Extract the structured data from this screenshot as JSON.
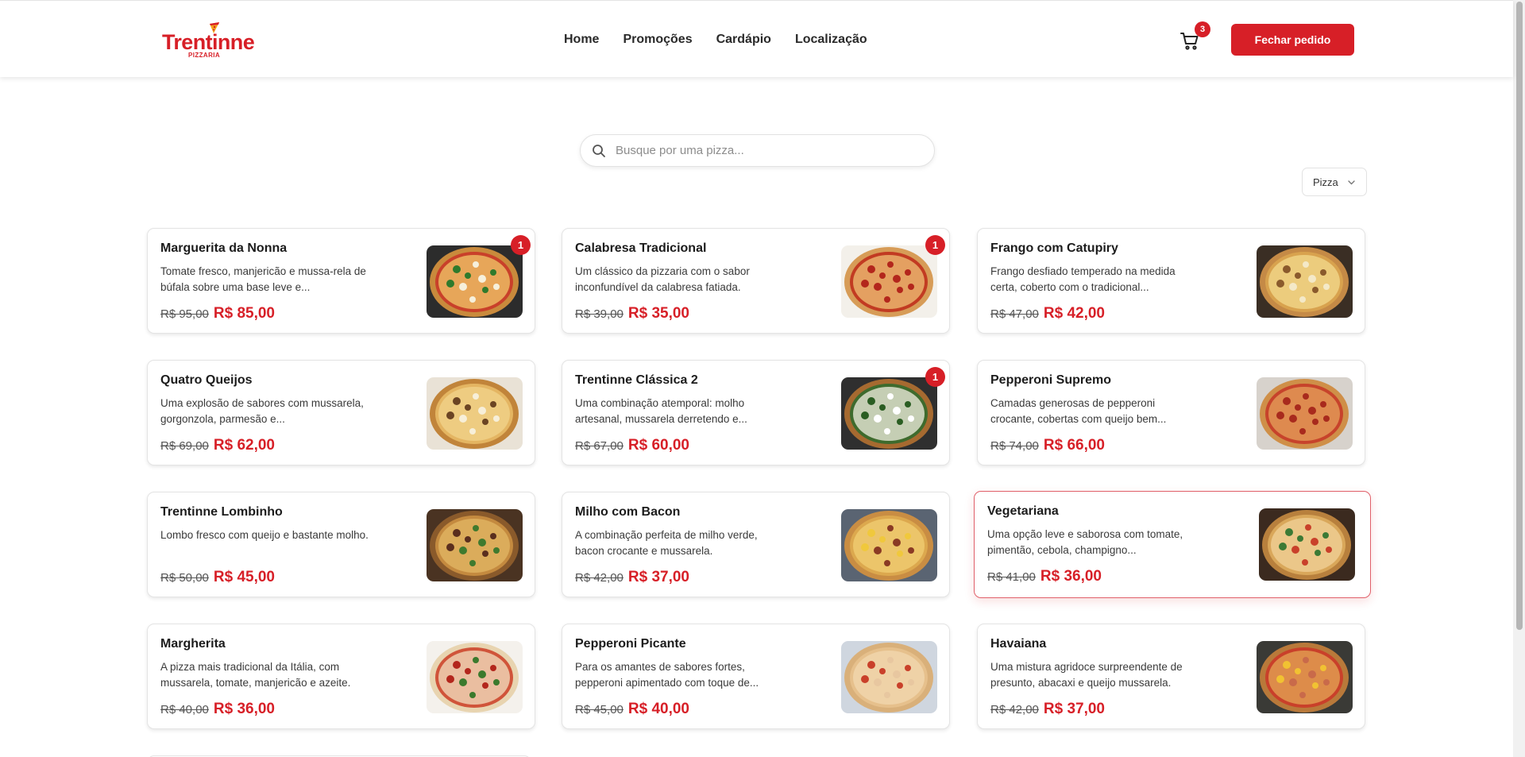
{
  "brand": {
    "name": "Trentinne",
    "subtitle": "PIZZARIA"
  },
  "nav": {
    "items": [
      "Home",
      "Promoções",
      "Cardápio",
      "Localização"
    ]
  },
  "cart": {
    "count": "3",
    "icon": "cart-icon"
  },
  "checkout": {
    "label": "Fechar pedido"
  },
  "search": {
    "placeholder": "Busque por uma pizza...",
    "value": ""
  },
  "filter": {
    "selected": "Pizza"
  },
  "colors": {
    "brand_red": "#d71f27",
    "text_dark": "#1c1c1c"
  },
  "products": [
    {
      "name": "Marguerita da Nonna",
      "description": "Tomate fresco, manjericão e mussa-rela de búfala sobre uma base leve e...",
      "old_price": "R$ 95,00",
      "price": "R$ 85,00",
      "quantity": "1",
      "selected": false
    },
    {
      "name": "Calabresa Tradicional",
      "description": "Um clássico da pizzaria com o sabor inconfundível da calabresa fatiada.",
      "old_price": "R$ 39,00",
      "price": "R$ 35,00",
      "quantity": "1",
      "selected": false
    },
    {
      "name": "Frango com Catupiry",
      "description": "Frango desfiado temperado na medida certa, coberto com o tradicional...",
      "old_price": "R$ 47,00",
      "price": "R$ 42,00",
      "quantity": "",
      "selected": false
    },
    {
      "name": "Quatro Queijos",
      "description": "Uma explosão de sabores com mussarela, gorgonzola, parmesão e...",
      "old_price": "R$ 69,00",
      "price": "R$ 62,00",
      "quantity": "",
      "selected": false
    },
    {
      "name": "Trentinne Clássica 2",
      "description": "Uma combinação atemporal: molho artesanal, mussarela derretendo e...",
      "old_price": "R$ 67,00",
      "price": "R$ 60,00",
      "quantity": "1",
      "selected": false
    },
    {
      "name": "Pepperoni Supremo",
      "description": "Camadas generosas de pepperoni crocante, cobertas com queijo bem...",
      "old_price": "R$ 74,00",
      "price": "R$ 66,00",
      "quantity": "",
      "selected": false
    },
    {
      "name": "Trentinne Lombinho",
      "description": "Lombo fresco com queijo e bastante molho.",
      "old_price": "R$ 50,00",
      "price": "R$ 45,00",
      "quantity": "",
      "selected": false
    },
    {
      "name": "Milho com Bacon",
      "description": "A combinação perfeita de milho verde, bacon crocante e mussarela.",
      "old_price": "R$ 42,00",
      "price": "R$ 37,00",
      "quantity": "",
      "selected": false
    },
    {
      "name": "Vegetariana",
      "description": "Uma opção leve e saborosa com tomate, pimentão, cebola, champigno...",
      "old_price": "R$ 41,00",
      "price": "R$ 36,00",
      "quantity": "",
      "selected": true
    },
    {
      "name": "Margherita",
      "description": "A pizza mais tradicional da Itália, com mussarela, tomate, manjericão e azeite.",
      "old_price": "R$ 40,00",
      "price": "R$ 36,00",
      "quantity": "",
      "selected": false
    },
    {
      "name": "Pepperoni Picante",
      "description": "Para os amantes de sabores fortes, pepperoni apimentado com toque de...",
      "old_price": "R$ 45,00",
      "price": "R$ 40,00",
      "quantity": "",
      "selected": false
    },
    {
      "name": "Havaiana",
      "description": "Uma mistura agridoce surpreendente de presunto, abacaxi e queijo mussarela.",
      "old_price": "R$ 42,00",
      "price": "R$ 37,00",
      "quantity": "",
      "selected": false
    }
  ]
}
